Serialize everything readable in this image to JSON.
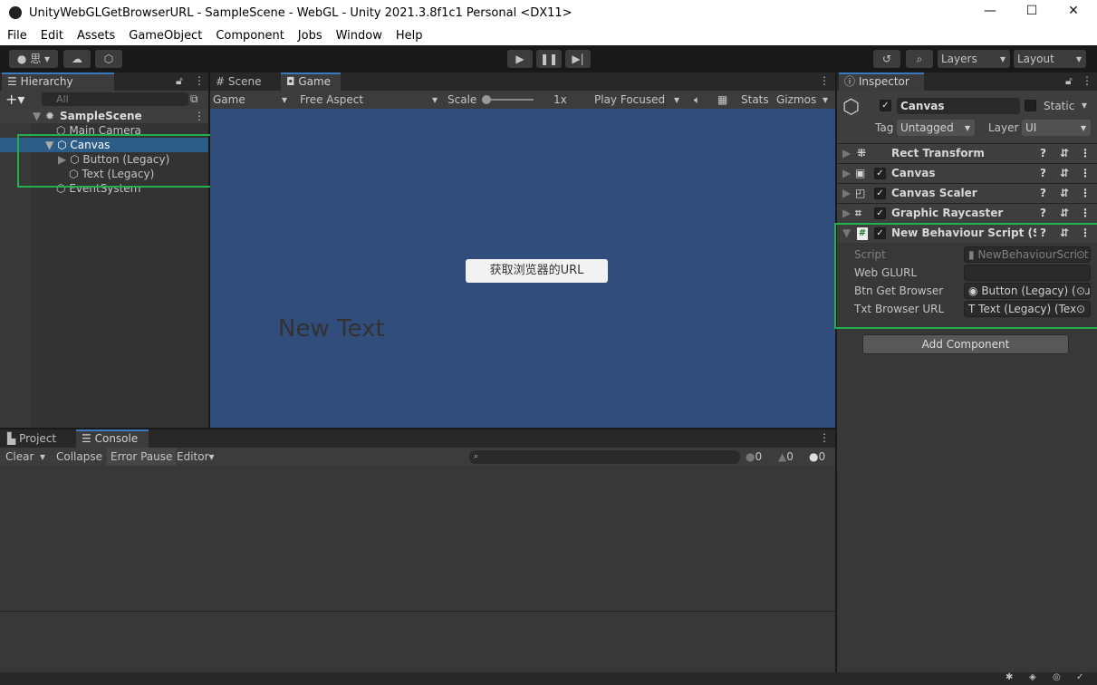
{
  "window": {
    "title": "UnityWebGLGetBrowserURL - SampleScene - WebGL - Unity 2021.3.8f1c1 Personal <DX11>",
    "minimize": "—",
    "maximize": "☐",
    "close": "✕"
  },
  "menu": [
    "File",
    "Edit",
    "Assets",
    "GameObject",
    "Component",
    "Jobs",
    "Window",
    "Help"
  ],
  "toolbar": {
    "account": "思",
    "layers": "Layers",
    "layout": "Layout"
  },
  "hierarchy": {
    "tab": "Hierarchy",
    "search_placeholder": "All",
    "scene": "SampleScene",
    "items": [
      {
        "label": "Main Camera"
      },
      {
        "label": "Canvas"
      },
      {
        "label": "Button (Legacy)"
      },
      {
        "label": "Text (Legacy)"
      },
      {
        "label": "EventSystem"
      }
    ]
  },
  "game": {
    "tabs": [
      "Scene",
      "Game"
    ],
    "display": "Game",
    "aspect": "Free Aspect",
    "scale_label": "Scale",
    "scale_value": "1x",
    "play_mode": "Play Focused",
    "stats": "Stats",
    "gizmos": "Gizmos",
    "button_text": "获取浏览器的URL",
    "text": "New Text",
    "bg_color": "#314d7b"
  },
  "inspector": {
    "tab": "Inspector",
    "name": "Canvas",
    "static": "Static",
    "tag_label": "Tag",
    "tag": "Untagged",
    "layer_label": "Layer",
    "layer": "UI",
    "components": [
      "Rect Transform",
      "Canvas",
      "Canvas Scaler",
      "Graphic Raycaster",
      "New Behaviour Script (Script)"
    ],
    "fields": [
      {
        "label": "Script",
        "value": "NewBehaviourScript"
      },
      {
        "label": "Web GLURL",
        "value": ""
      },
      {
        "label": "Btn Get Browser",
        "value": "Button (Legacy) (Button)"
      },
      {
        "label": "Txt Browser URL",
        "value": "Text (Legacy) (Text)"
      }
    ],
    "add_component": "Add Component"
  },
  "console": {
    "tabs": [
      "Project",
      "Console"
    ],
    "clear": "Clear",
    "collapse": "Collapse",
    "error_pause": "Error Pause",
    "editor": "Editor",
    "info_count": "0",
    "warn_count": "0",
    "error_count": "0"
  }
}
